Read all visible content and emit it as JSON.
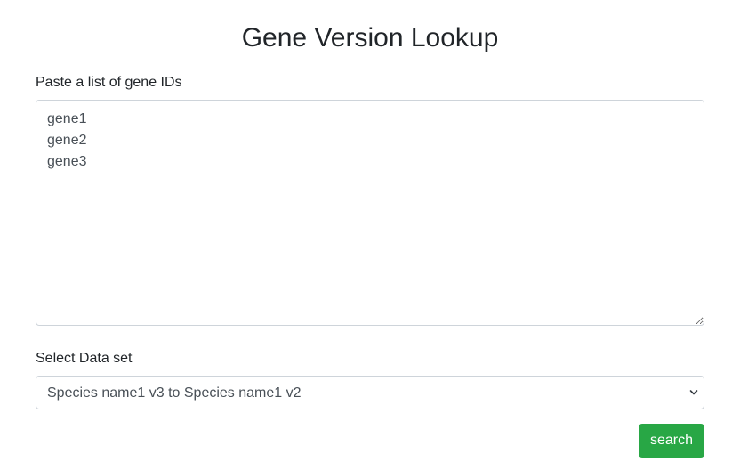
{
  "page": {
    "title": "Gene Version Lookup"
  },
  "gene_input": {
    "label": "Paste a list of gene IDs",
    "value": "gene1\ngene2\ngene3"
  },
  "dataset": {
    "label": "Select Data set",
    "selected": "Species name1 v3 to Species name1 v2"
  },
  "actions": {
    "search_label": "search"
  },
  "colors": {
    "button_green": "#28a745",
    "border_gray": "#ced4da",
    "text_dark": "#212529"
  }
}
